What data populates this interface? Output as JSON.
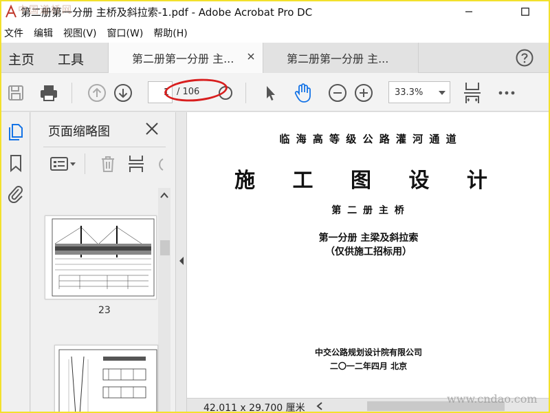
{
  "window": {
    "title": "第二册第一分册 主桥及斜拉索-1.pdf - Adobe Acrobat Pro DC"
  },
  "menu": [
    "文件",
    "编辑",
    "视图(V)",
    "窗口(W)",
    "帮助(H)"
  ],
  "tabs": {
    "home": "主页",
    "tools": "工具",
    "documents": [
      {
        "label": "第二册第一分册 主...",
        "active": true
      },
      {
        "label": "第二册第一分册 主...",
        "active": false
      }
    ]
  },
  "toolbar": {
    "page_current": "1",
    "page_total": "/ 106",
    "zoom": "33.3%"
  },
  "thumbnails": {
    "title": "页面缩略图",
    "page_label": "23"
  },
  "document": {
    "line1": "临 海 高 等 级 公 路 灌 河 通 道",
    "line2": "施 工 图 设 计",
    "line3": "第 二 册 主 桥",
    "line4": "第一分册    主梁及斜拉索",
    "line5": "（仅供施工招标用）",
    "line6": "中交公路规划设计院有限公司",
    "line7": "二〇一二年四月 北京"
  },
  "status": {
    "page_size": "42.011 x 29.700 厘米"
  },
  "watermark": {
    "logo_text": "中国道桥网",
    "url": "www.cndao.com"
  },
  "colors": {
    "annotation_red": "#d81e1e",
    "acrobat_blue": "#1473e6",
    "frame_yellow": "#f3e12c"
  }
}
